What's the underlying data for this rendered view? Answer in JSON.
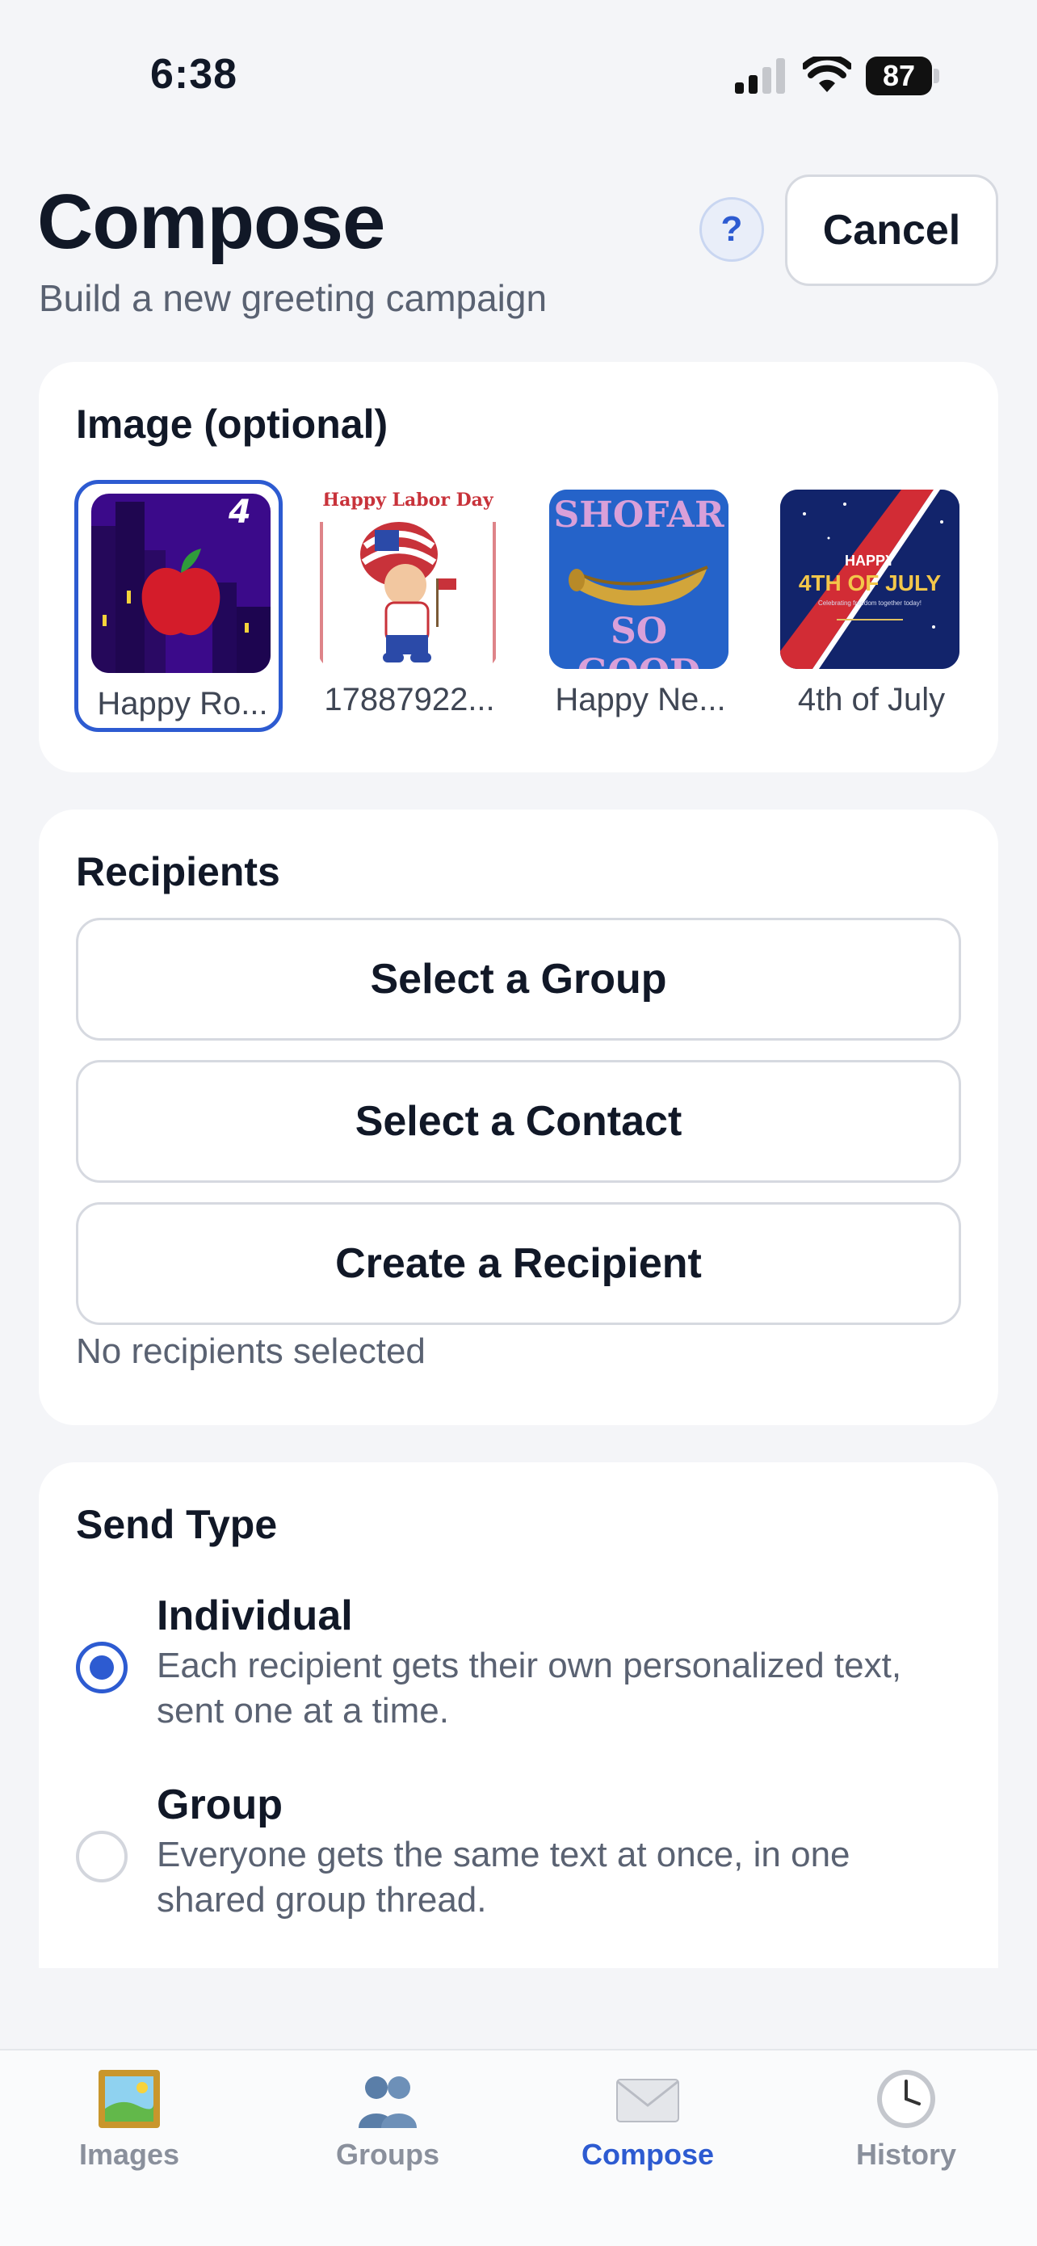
{
  "status_bar": {
    "time": "6:38",
    "battery": "87"
  },
  "header": {
    "title": "Compose",
    "subtitle": "Build a new greeting campaign",
    "help_label": "?",
    "cancel_label": "Cancel"
  },
  "image_section": {
    "title": "Image (optional)",
    "images": [
      {
        "label": "Happy Ro...",
        "selected": true
      },
      {
        "label": "17887922...",
        "selected": false
      },
      {
        "label": "Happy Ne...",
        "selected": false
      },
      {
        "label": "4th of July",
        "selected": false
      }
    ],
    "thumb_text": {
      "labor_day": "Happy Labor Day",
      "shofar_top": "SHOFAR",
      "shofar_bottom": "SO GOOD",
      "july_happy": "HAPPY",
      "july_main": "4TH OF JULY",
      "july_small": "Celebrating freedom together today!"
    }
  },
  "recipients": {
    "title": "Recipients",
    "select_group": "Select a Group",
    "select_contact": "Select a Contact",
    "create_recipient": "Create a Recipient",
    "status": "No recipients selected"
  },
  "send_type": {
    "title": "Send Type",
    "options": [
      {
        "title": "Individual",
        "description": "Each recipient gets their own personalized text, sent one at a time.",
        "selected": true
      },
      {
        "title": "Group",
        "description": "Everyone gets the same text at once, in one shared group thread.",
        "selected": false
      }
    ]
  },
  "tab_bar": {
    "tabs": [
      {
        "label": "Images",
        "icon": "framed-picture-icon",
        "active": false
      },
      {
        "label": "Groups",
        "icon": "people-icon",
        "active": false
      },
      {
        "label": "Compose",
        "icon": "envelope-icon",
        "active": true
      },
      {
        "label": "History",
        "icon": "clock-icon",
        "active": false
      }
    ]
  },
  "colors": {
    "accent": "#2d5bd1",
    "background": "#f4f5f8",
    "card": "#ffffff"
  }
}
